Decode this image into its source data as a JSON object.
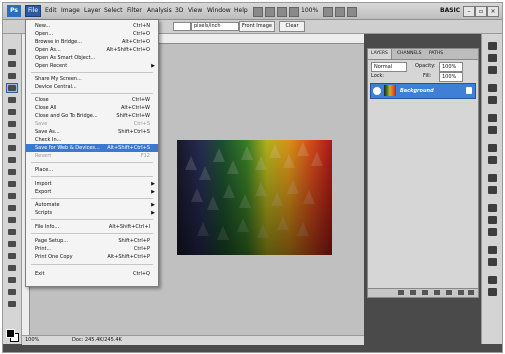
{
  "menubar": {
    "logo": "Ps",
    "items": [
      "File",
      "Edit",
      "Image",
      "Layer",
      "Select",
      "Filter",
      "Analysis",
      "3D",
      "View",
      "Window",
      "Help"
    ],
    "zoom": "100%",
    "workspace": "BASIC"
  },
  "options": {
    "resolution_unit": "pixels/inch",
    "front_image": "Front Image",
    "clear": "Clear"
  },
  "file_menu": [
    {
      "label": "New...",
      "shortcut": "Ctrl+N"
    },
    {
      "label": "Open...",
      "shortcut": "Ctrl+O"
    },
    {
      "label": "Browse in Bridge...",
      "shortcut": "Alt+Ctrl+O"
    },
    {
      "label": "Open As...",
      "shortcut": "Alt+Shift+Ctrl+O"
    },
    {
      "label": "Open As Smart Object..."
    },
    {
      "label": "Open Recent",
      "submenu": true
    },
    {
      "label": "Share My Screen..."
    },
    {
      "label": "Device Central..."
    },
    {
      "label": "Close",
      "shortcut": "Ctrl+W"
    },
    {
      "label": "Close All",
      "shortcut": "Alt+Ctrl+W"
    },
    {
      "label": "Close and Go To Bridge...",
      "shortcut": "Shift+Ctrl+W"
    },
    {
      "label": "Save",
      "shortcut": "Ctrl+S",
      "disabled": true
    },
    {
      "label": "Save As...",
      "shortcut": "Shift+Ctrl+S"
    },
    {
      "label": "Check In..."
    },
    {
      "label": "Save for Web & Devices...",
      "shortcut": "Alt+Shift+Ctrl+S",
      "highlighted": true
    },
    {
      "label": "Revert",
      "shortcut": "F12",
      "disabled": true
    },
    {
      "label": "Place..."
    },
    {
      "label": "Import",
      "submenu": true
    },
    {
      "label": "Export",
      "submenu": true
    },
    {
      "label": "Automate",
      "submenu": true
    },
    {
      "label": "Scripts",
      "submenu": true
    },
    {
      "label": "File Info...",
      "shortcut": "Alt+Shift+Ctrl+I"
    },
    {
      "label": "Page Setup...",
      "shortcut": "Shift+Ctrl+P"
    },
    {
      "label": "Print...",
      "shortcut": "Ctrl+P"
    },
    {
      "label": "Print One Copy",
      "shortcut": "Alt+Shift+Ctrl+P"
    },
    {
      "label": "Exit",
      "shortcut": "Ctrl+Q"
    }
  ],
  "layers_panel": {
    "tabs": [
      "LAYERS",
      "CHANNELS",
      "PATHS"
    ],
    "blend_mode": "Normal",
    "opacity_label": "Opacity:",
    "opacity": "100%",
    "lock_label": "Lock:",
    "fill_label": "Fill:",
    "fill": "100%",
    "layers": [
      {
        "name": "Background"
      }
    ]
  },
  "status": {
    "zoom": "100%",
    "doc": "Doc: 245.4K/245.4K"
  }
}
